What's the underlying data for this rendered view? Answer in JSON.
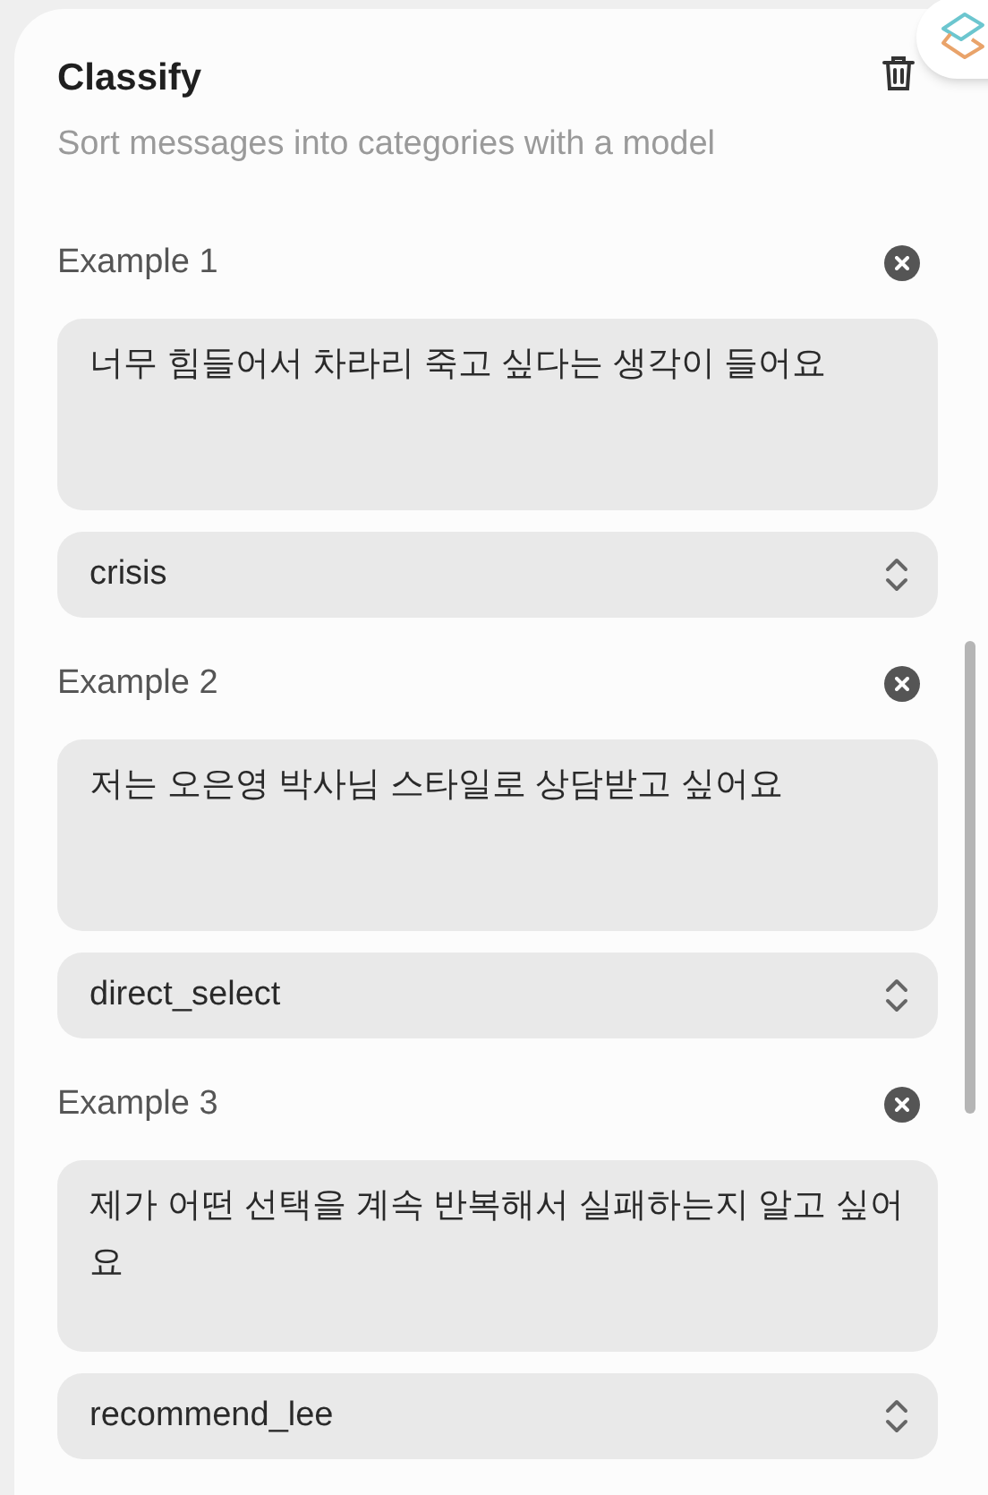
{
  "panel": {
    "title": "Classify",
    "subtitle": "Sort messages into categories with a model"
  },
  "examples": [
    {
      "label": "Example 1",
      "message": "너무 힘들어서 차라리 죽고 싶다는 생각이 들어요",
      "category": "crisis"
    },
    {
      "label": "Example 2",
      "message": "저는 오은영 박사님 스타일로 상담받고 싶어요",
      "category": "direct_select"
    },
    {
      "label": "Example 3",
      "message": "제가 어떤 선택을 계속 반복해서 실패하는지 알고 싶어요",
      "category": "recommend_lee"
    }
  ]
}
